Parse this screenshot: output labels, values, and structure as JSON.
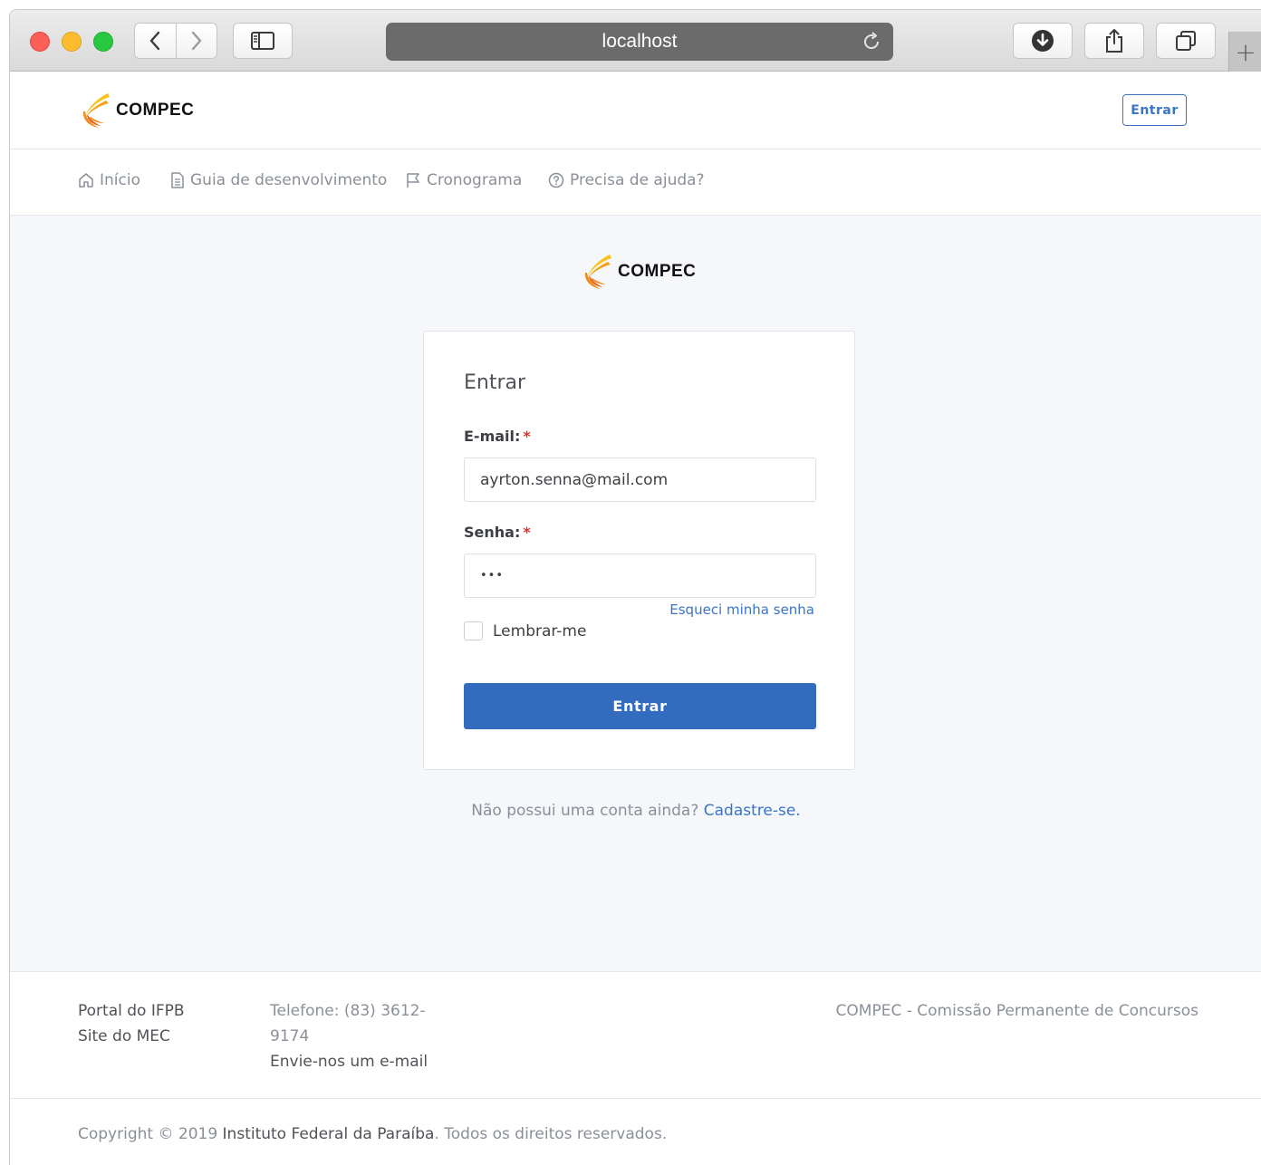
{
  "browser": {
    "url": "localhost",
    "new_tab_label": "+"
  },
  "brand": {
    "name": "COMPEC",
    "colors": {
      "primary": "#336cbe",
      "logo_orange": "#f28c1e",
      "logo_yellow": "#f7c21a"
    }
  },
  "header": {
    "login_button": "Entrar"
  },
  "nav": {
    "items": [
      {
        "label": "Início",
        "icon": "home-icon"
      },
      {
        "label": "Guia de desenvolvimento",
        "icon": "document-icon"
      },
      {
        "label": "Cronograma",
        "icon": "flag-icon"
      },
      {
        "label": "Precisa de ajuda?",
        "icon": "help-circle-icon"
      }
    ]
  },
  "login": {
    "title": "Entrar",
    "email_label": "E-mail:",
    "email_value": "ayrton.senna@mail.com",
    "password_label": "Senha:",
    "password_value": "•••",
    "required_mark": "*",
    "forgot_link": "Esqueci minha senha",
    "remember_label": "Lembrar-me",
    "submit": "Entrar"
  },
  "signup": {
    "prompt": "Não possui uma conta ainda?",
    "link": "Cadastre-se."
  },
  "footer": {
    "links": [
      "Portal do IFPB",
      "Site do MEC"
    ],
    "phone_line1": "Telefone: (83) 3612-",
    "phone_line2": "9174",
    "email_link": "Envie-nos um e-mail",
    "org": "COMPEC - Comissão Permanente de Concursos",
    "copyright_prefix": "Copyright © 2019",
    "copyright_org": "Instituto Federal da Paraíba",
    "copyright_suffix": ". Todos os direitos reservados."
  }
}
